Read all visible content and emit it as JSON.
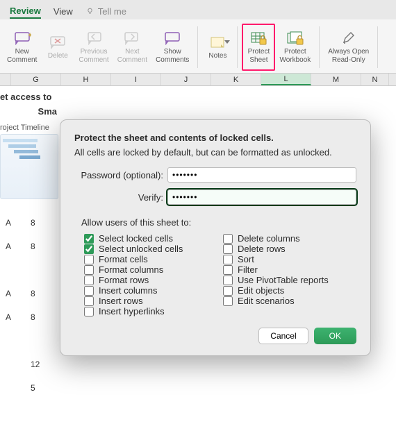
{
  "tabs": {
    "review": "Review",
    "view": "View",
    "tellme": "Tell me"
  },
  "ribbon": {
    "new_comment": "New\nComment",
    "delete": "Delete",
    "previous": "Previous\nComment",
    "next": "Next\nComment",
    "show_comments": "Show\nComments",
    "notes": "Notes",
    "protect_sheet": "Protect\nSheet",
    "protect_workbook": "Protect\nWorkbook",
    "always_open_ro": "Always Open\nRead-Only"
  },
  "columns": [
    "G",
    "H",
    "I",
    "J",
    "K",
    "L",
    "M",
    "N"
  ],
  "active_col_index": 5,
  "side": {
    "line1": "et access to",
    "line2": "Sma",
    "timeline": "roject Timeline"
  },
  "rows": [
    {
      "a": "A",
      "n": "8"
    },
    {
      "a": "A",
      "n": "8"
    },
    {
      "a": "",
      "n": ""
    },
    {
      "a": "A",
      "n": "8"
    },
    {
      "a": "A",
      "n": "8"
    },
    {
      "a": "",
      "n": ""
    },
    {
      "a": "",
      "n": "12"
    },
    {
      "a": "",
      "n": "5"
    }
  ],
  "dialog": {
    "title": "Protect the sheet and contents of locked cells.",
    "subtitle": "All cells are locked by default, but can be formatted as unlocked.",
    "password_label": "Password (optional):",
    "password_value": "•••••••",
    "verify_label": "Verify:",
    "verify_value": "•••••••",
    "allow_label": "Allow users of this sheet to:",
    "checks_left": [
      {
        "label": "Select locked cells",
        "checked": true
      },
      {
        "label": "Select unlocked cells",
        "checked": true
      },
      {
        "label": "Format cells",
        "checked": false
      },
      {
        "label": "Format columns",
        "checked": false
      },
      {
        "label": "Format rows",
        "checked": false
      },
      {
        "label": "Insert columns",
        "checked": false
      },
      {
        "label": "Insert rows",
        "checked": false
      },
      {
        "label": "Insert hyperlinks",
        "checked": false
      }
    ],
    "checks_right": [
      {
        "label": "Delete columns",
        "checked": false
      },
      {
        "label": "Delete rows",
        "checked": false
      },
      {
        "label": "Sort",
        "checked": false
      },
      {
        "label": "Filter",
        "checked": false
      },
      {
        "label": "Use PivotTable reports",
        "checked": false
      },
      {
        "label": "Edit objects",
        "checked": false
      },
      {
        "label": "Edit scenarios",
        "checked": false
      }
    ],
    "cancel": "Cancel",
    "ok": "OK"
  }
}
